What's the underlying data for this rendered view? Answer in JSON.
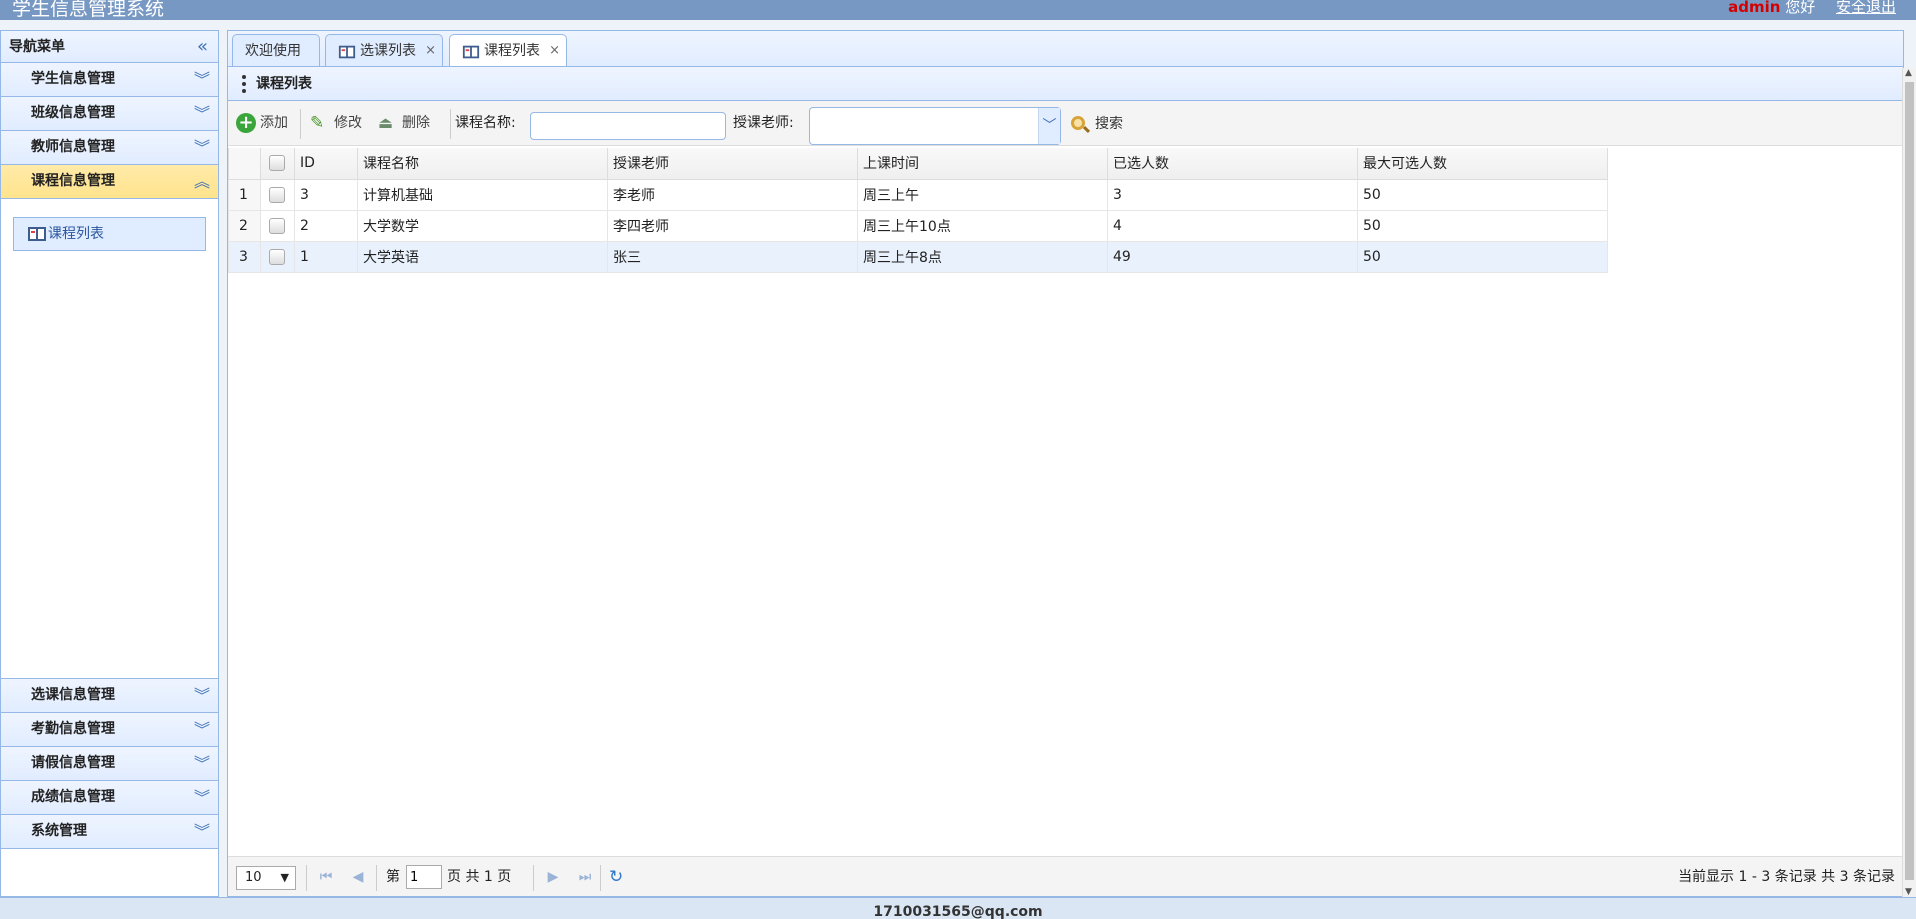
{
  "header": {
    "title": "学生信息管理系统",
    "username": "admin",
    "greeting": "您好",
    "logout": "安全退出"
  },
  "nav": {
    "title": "导航菜单",
    "groups_top": [
      {
        "label": "学生信息管理"
      },
      {
        "label": "班级信息管理"
      },
      {
        "label": "教师信息管理"
      },
      {
        "label": "课程信息管理"
      }
    ],
    "active_leaf": "课程列表",
    "groups_bottom": [
      {
        "label": "选课信息管理"
      },
      {
        "label": "考勤信息管理"
      },
      {
        "label": "请假信息管理"
      },
      {
        "label": "成绩信息管理"
      },
      {
        "label": "系统管理"
      }
    ]
  },
  "tabs": [
    {
      "label": "欢迎使用"
    },
    {
      "label": "选课列表"
    },
    {
      "label": "课程列表"
    }
  ],
  "panel": {
    "title": "课程列表"
  },
  "toolbar": {
    "add": "添加",
    "edit": "修改",
    "delete": "删除",
    "course_name_label": "课程名称:",
    "course_name_value": "",
    "teacher_label": "授课老师:",
    "teacher_value": "",
    "search": "搜索"
  },
  "table": {
    "columns": [
      "ID",
      "课程名称",
      "授课老师",
      "上课时间",
      "已选人数",
      "最大可选人数"
    ],
    "rows": [
      {
        "num": "1",
        "id": "3",
        "name": "计算机基础",
        "teacher": "李老师",
        "time": "周三上午",
        "selected": "3",
        "max": "50"
      },
      {
        "num": "2",
        "id": "2",
        "name": "大学数学",
        "teacher": "李四老师",
        "time": "周三上午10点",
        "selected": "4",
        "max": "50"
      },
      {
        "num": "3",
        "id": "1",
        "name": "大学英语",
        "teacher": "张三",
        "time": "周三上午8点",
        "selected": "49",
        "max": "50"
      }
    ]
  },
  "pager": {
    "page_size": "10",
    "page_prefix": "第",
    "page_value": "1",
    "page_suffix": "页 共 1 页",
    "info": "当前显示 1 - 3 条记录 共 3 条记录"
  },
  "footer": {
    "text": "1710031565@qq.com"
  },
  "colors": {
    "header_bg": "#7898c4",
    "border": "#95b8e7",
    "active_group": "#ffe48d",
    "username": "#d40000"
  }
}
